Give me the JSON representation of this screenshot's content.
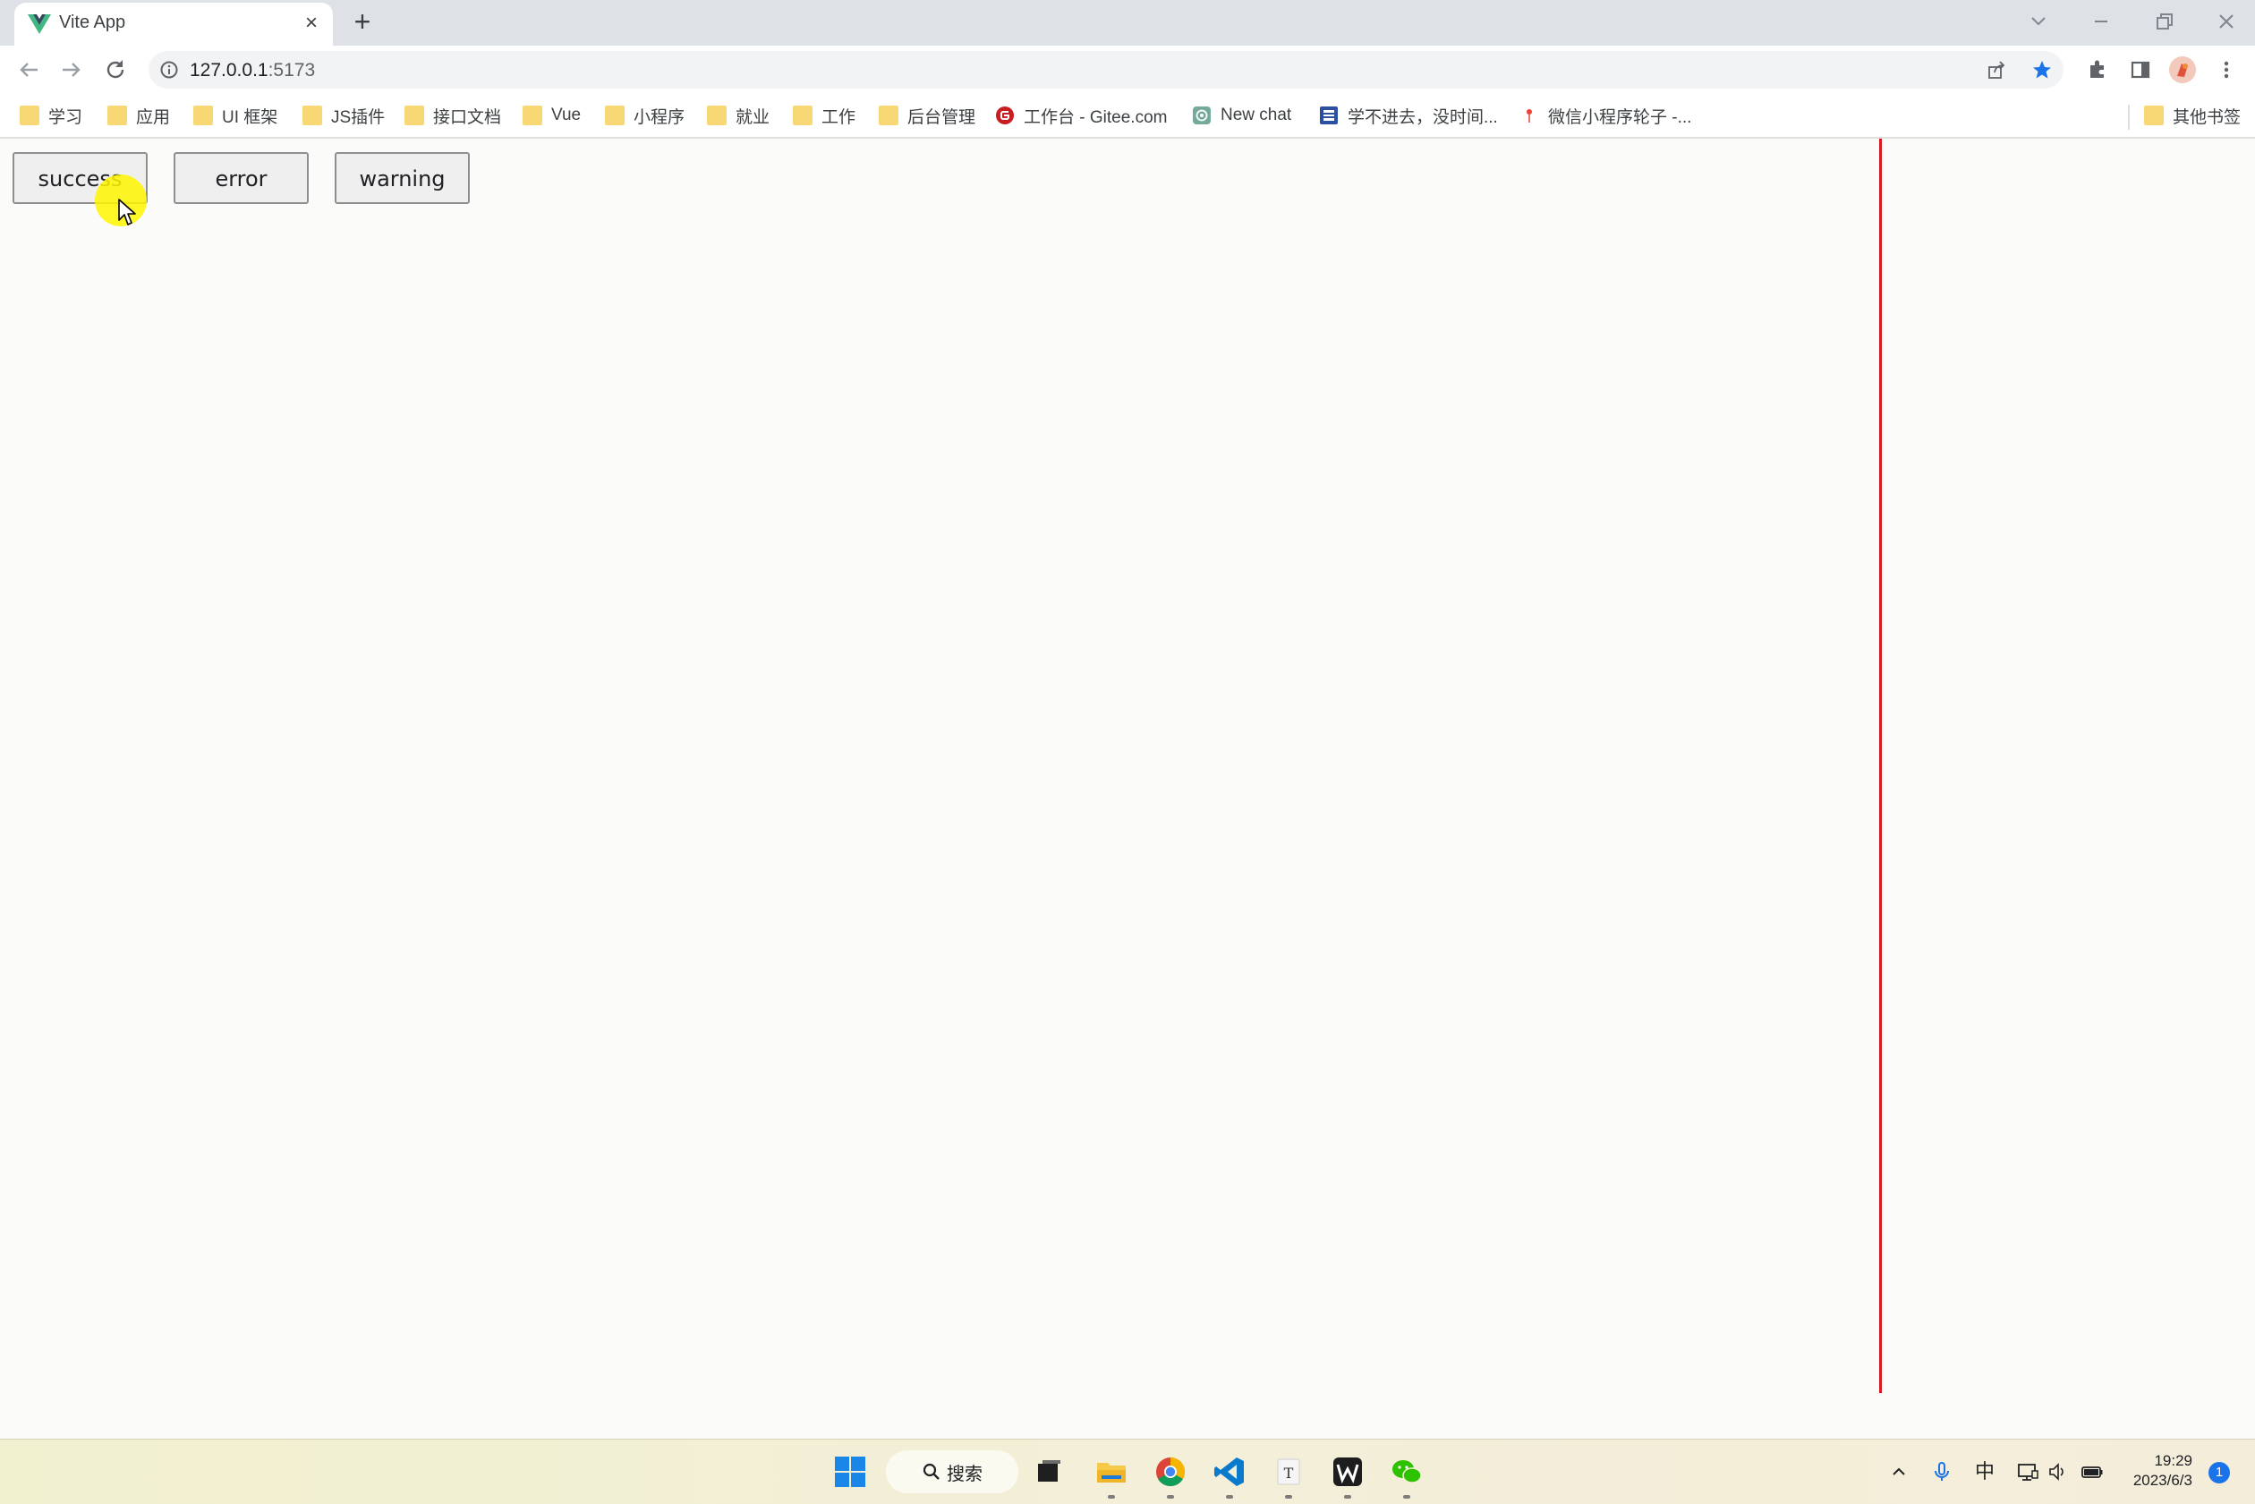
{
  "browser": {
    "tab": {
      "title": "Vite App",
      "close": "×"
    },
    "new_tab": "+",
    "url": {
      "host": "127.0.0.1",
      "port": ":5173"
    }
  },
  "bookmarks": [
    {
      "label": "学习",
      "icon": "folder-icon"
    },
    {
      "label": "应用",
      "icon": "folder-icon"
    },
    {
      "label": "UI 框架",
      "icon": "folder-icon"
    },
    {
      "label": "JS插件",
      "icon": "folder-icon"
    },
    {
      "label": "接口文档",
      "icon": "folder-icon"
    },
    {
      "label": "Vue",
      "icon": "folder-icon"
    },
    {
      "label": "小程序",
      "icon": "folder-icon"
    },
    {
      "label": "就业",
      "icon": "folder-icon"
    },
    {
      "label": "工作",
      "icon": "folder-icon"
    },
    {
      "label": "后台管理",
      "icon": "folder-icon"
    },
    {
      "label": "工作台 - Gitee.com",
      "icon": "gitee-icon"
    },
    {
      "label": "New chat",
      "icon": "openai-icon"
    },
    {
      "label": "学不进去，没时间...",
      "icon": "site-icon"
    },
    {
      "label": "微信小程序轮子 -...",
      "icon": "pin-icon"
    }
  ],
  "other_bookmarks": "其他书签",
  "page": {
    "buttons": [
      "success",
      "error",
      "warning"
    ]
  },
  "taskbar": {
    "search_label": "搜索",
    "ime": "中",
    "time": "19:29",
    "date": "2023/6/3",
    "notification_count": "1"
  },
  "colors": {
    "accent_line": "#d71920",
    "cursor_highlight": "#fff400",
    "star": "#1a73e8"
  }
}
